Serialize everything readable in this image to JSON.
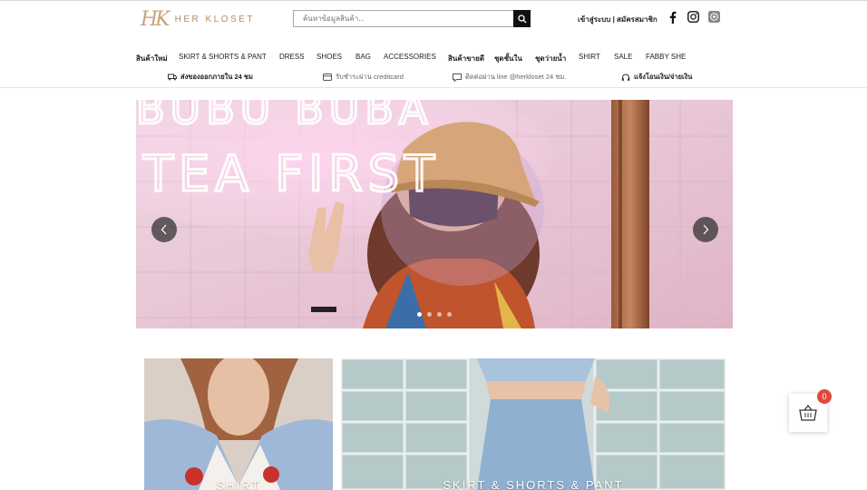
{
  "header": {
    "logo_mark": "HK",
    "logo_text": "HER KLOSET",
    "search_placeholder": "ค้นหาข้อมูลสินค้า...",
    "login": "เข้าสู่ระบบ",
    "separator": "|",
    "register": "สมัครสมาชิก"
  },
  "nav": {
    "items": [
      "สินค้าใหม่",
      "SKIRT & SHORTS & PANT",
      "DRESS",
      "SHOES",
      "BAG",
      "ACCESSORIES",
      "สินค้าขายดี",
      "ชุดชั้นใน",
      "ชุดว่ายน้ำ",
      "SHIRT",
      "SALE",
      "FABBY SHE"
    ]
  },
  "info": {
    "shipping": "ส่งของออกภายใน 24 ชม",
    "payment": "รับชำระผ่าน creditcard",
    "contact": "ติดต่อผ่าน line @herkloset 24 ชม.",
    "notify": "แจ้งโอนเงิน/จ่ายเงิน"
  },
  "hero": {
    "neon_line1": "BUBU BUBA",
    "neon_line2": "TEA FIRST",
    "slide_count": 4,
    "active_slide": 1
  },
  "categories": [
    {
      "label": "SHIRT"
    },
    {
      "label": "SKIRT & SHORTS & PANT"
    }
  ],
  "cart": {
    "count": "0"
  },
  "colors": {
    "accent": "#e0493a",
    "logo": "#c9a27a",
    "dark": "#111111"
  }
}
